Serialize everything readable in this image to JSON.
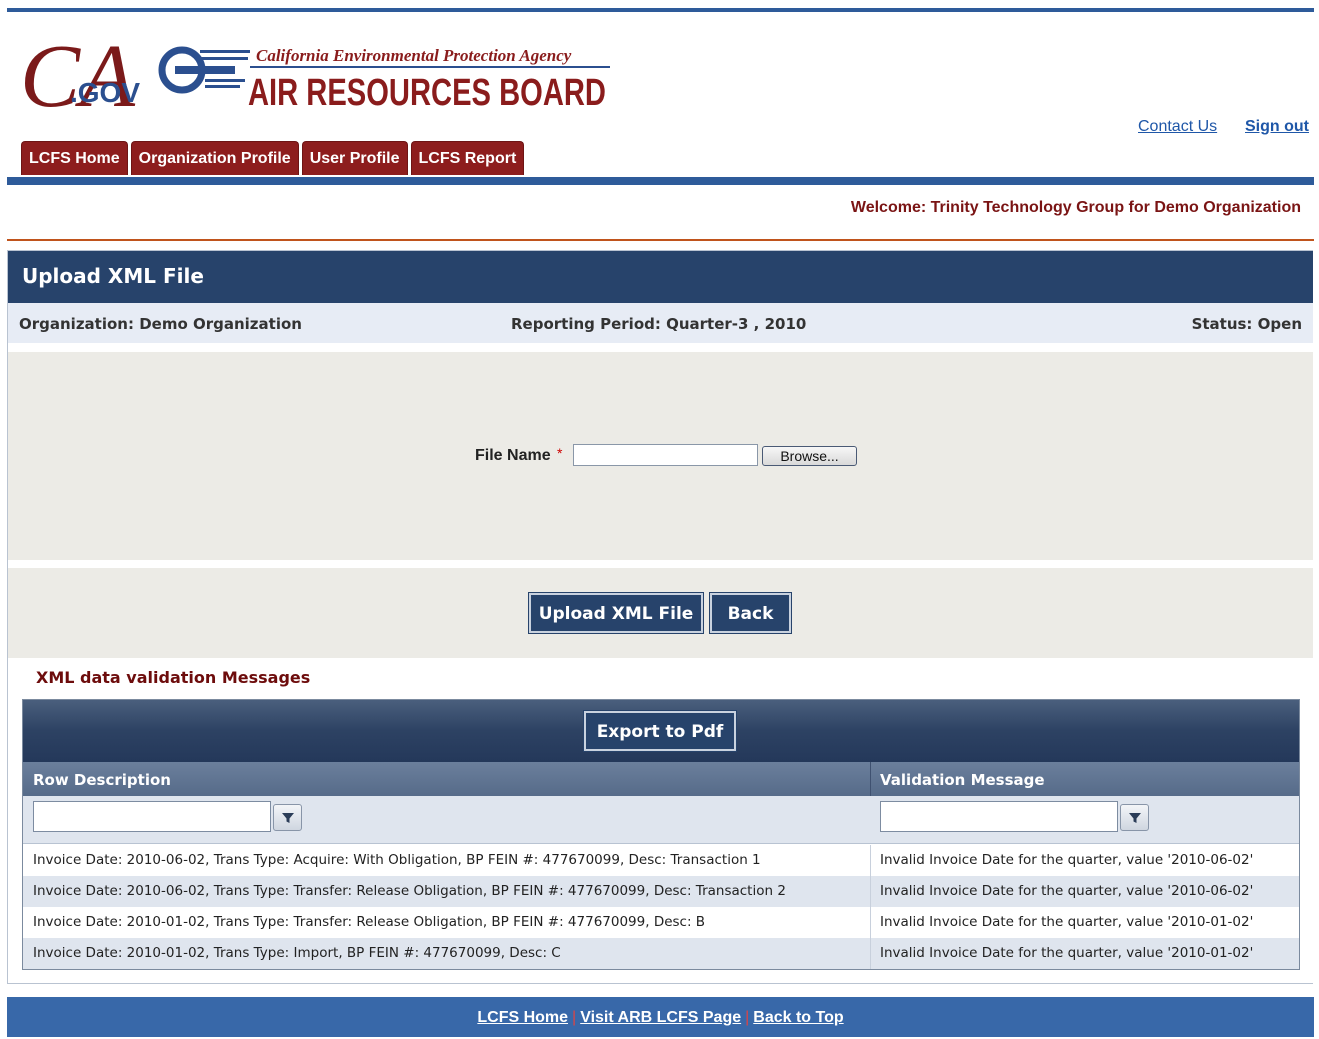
{
  "brand": {
    "ca": "CA",
    "gov": ".GOV",
    "agency": "California Environmental Protection Agency",
    "board": "AIR RESOURCES BOARD"
  },
  "header_links": {
    "contact_us": "Contact Us",
    "sign_out": "Sign out"
  },
  "tabs": [
    {
      "label": "LCFS Home"
    },
    {
      "label": "Organization Profile"
    },
    {
      "label": "User Profile"
    },
    {
      "label": "LCFS Report"
    }
  ],
  "welcome": "Welcome: Trinity Technology Group for Demo Organization",
  "panel": {
    "title": "Upload XML File",
    "organization": "Organization: Demo Organization",
    "reporting_period": "Reporting Period: Quarter-3 , 2010",
    "status": "Status: Open"
  },
  "upload": {
    "file_label": "File Name",
    "required_mark": "*",
    "file_value": "",
    "browse_label": "Browse..."
  },
  "actions": {
    "upload_label": "Upload XML File",
    "back_label": "Back"
  },
  "validation": {
    "heading": "XML data validation Messages",
    "export_label": "Export to Pdf",
    "columns": [
      "Row Description",
      "Validation Message"
    ],
    "rows": [
      {
        "description": "Invoice Date: 2010-06-02, Trans Type: Acquire: With Obligation, BP FEIN #: 477670099, Desc: Transaction 1",
        "message": "Invalid Invoice Date for the quarter, value '2010-06-02'"
      },
      {
        "description": "Invoice Date: 2010-06-02, Trans Type: Transfer: Release Obligation, BP FEIN #: 477670099, Desc: Transaction 2",
        "message": "Invalid Invoice Date for the quarter, value '2010-06-02'"
      },
      {
        "description": "Invoice Date: 2010-01-02, Trans Type: Transfer: Release Obligation, BP FEIN #: 477670099, Desc: B",
        "message": "Invalid Invoice Date for the quarter, value '2010-01-02'"
      },
      {
        "description": "Invoice Date: 2010-01-02, Trans Type: Import, BP FEIN #: 477670099, Desc: C",
        "message": "Invalid Invoice Date for the quarter, value '2010-01-02'"
      }
    ]
  },
  "footer": {
    "home": "LCFS Home",
    "arb": "Visit ARB LCFS Page",
    "top": "Back to Top",
    "separator": "|"
  },
  "colors": {
    "nav_blue": "#2e5b9a",
    "tab_red": "#8d1d1d",
    "panel_navy": "#27436b"
  }
}
